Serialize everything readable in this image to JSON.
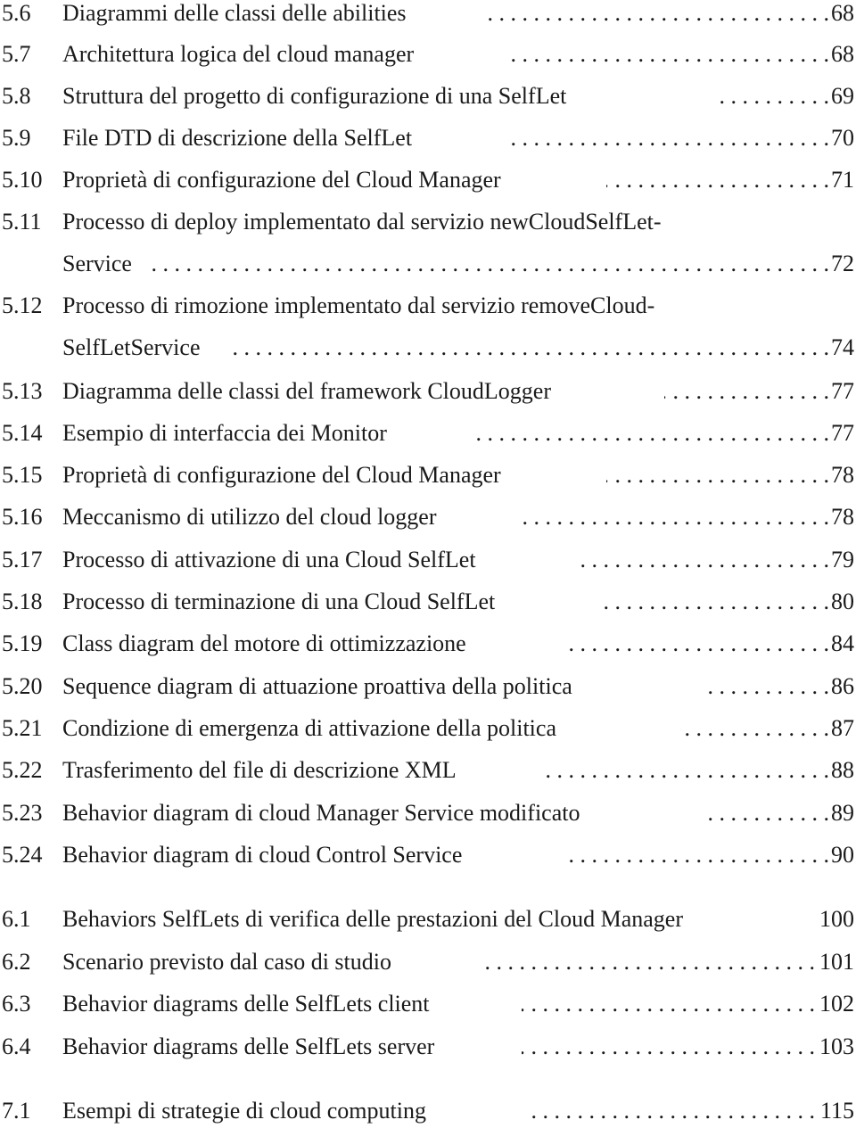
{
  "list_of_figures": [
    {
      "number": "5.6",
      "title": "Diagrammi delle classi delle abilities",
      "page": "68"
    },
    {
      "number": "5.7",
      "title": "Architettura logica del cloud manager",
      "page": "68"
    },
    {
      "number": "5.8",
      "title": "Struttura del progetto di configurazione di una SelfLet",
      "page": "69"
    },
    {
      "number": "5.9",
      "title": "File DTD di descrizione della SelfLet",
      "page": "70"
    },
    {
      "number": "5.10",
      "title": "Proprietà di configurazione del Cloud Manager",
      "page": "71"
    },
    {
      "number": "5.11",
      "title": "Processo di deploy implementato dal servizio newCloudSelfLet-",
      "title_cont": "Service",
      "page": "72"
    },
    {
      "number": "5.12",
      "title": "Processo di rimozione implementato dal servizio removeCloud-",
      "title_cont": "SelfLetService",
      "page": "74"
    },
    {
      "number": "5.13",
      "title": "Diagramma delle classi del framework CloudLogger",
      "page": "77"
    },
    {
      "number": "5.14",
      "title": "Esempio di interfaccia dei Monitor",
      "page": "77"
    },
    {
      "number": "5.15",
      "title": "Proprietà di configurazione del Cloud Manager",
      "page": "78"
    },
    {
      "number": "5.16",
      "title": "Meccanismo di utilizzo del cloud logger",
      "page": "78"
    },
    {
      "number": "5.17",
      "title": "Processo di attivazione di una Cloud SelfLet",
      "page": "79"
    },
    {
      "number": "5.18",
      "title": "Processo di terminazione di una Cloud SelfLet",
      "page": "80"
    },
    {
      "number": "5.19",
      "title": "Class diagram del motore di ottimizzazione",
      "page": "84"
    },
    {
      "number": "5.20",
      "title": "Sequence diagram di attuazione proattiva della politica",
      "page": "86"
    },
    {
      "number": "5.21",
      "title": "Condizione di emergenza di attivazione della politica",
      "page": "87"
    },
    {
      "number": "5.22",
      "title": "Trasferimento del file di descrizione XML",
      "page": "88"
    },
    {
      "number": "5.23",
      "title": "Behavior diagram di cloud Manager Service modificato",
      "page": "89"
    },
    {
      "number": "5.24",
      "title": "Behavior diagram di cloud Control Service",
      "page": "90"
    },
    {
      "number": "6.1",
      "title": "Behaviors SelfLets di verifica delle prestazioni del Cloud Manager",
      "page": "100"
    },
    {
      "number": "6.2",
      "title": "Scenario previsto dal caso di studio",
      "page": "101"
    },
    {
      "number": "6.3",
      "title": "Behavior diagrams delle SelfLets client",
      "page": "102"
    },
    {
      "number": "6.4",
      "title": "Behavior diagrams delle SelfLets server",
      "page": "103"
    },
    {
      "number": "7.1",
      "title": "Esempi di strategie di cloud computing",
      "page": "115"
    }
  ],
  "leader_dots": ". . . . . . . . . . . . . . . . . . . . . . . . . . . . . . . . . . . . . . . . . . . . . . . . . . . . . . . . . . . . . . . . . . . . . ."
}
